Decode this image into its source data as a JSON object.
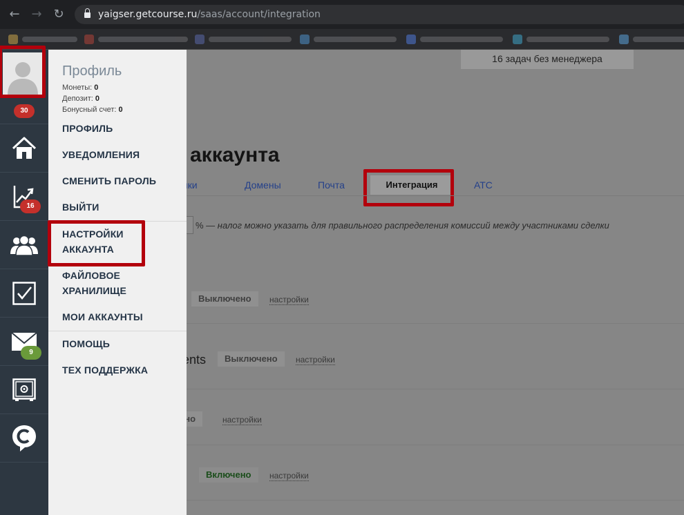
{
  "browser": {
    "back": "←",
    "forward": "→",
    "reload": "↻",
    "url_host": "yaigser.getcourse.ru",
    "url_path": "/saas/account/integration"
  },
  "sidebar": {
    "avatar_badge": "30",
    "growth_badge": "16",
    "mail_badge": "9"
  },
  "profile_menu": {
    "title": "Профиль",
    "coins_label": "Монеты:",
    "coins_value": "0",
    "deposit_label": "Депозит:",
    "deposit_value": "0",
    "bonus_label": "Бонусный счет:",
    "bonus_value": "0",
    "items": {
      "profile": "ПРОФИЛЬ",
      "notifications": "УВЕДОМЛЕНИЯ",
      "change_password": "СМЕНИТЬ ПАРОЛЬ",
      "logout": "ВЫЙТИ",
      "account_settings_1": "НАСТРОЙКИ",
      "account_settings_2": "АККАУНТА",
      "file_storage_1": "ФАЙЛОВОЕ",
      "file_storage_2": "ХРАНИЛИЩЕ",
      "my_accounts": "МОИ АККАУНТЫ",
      "help": "ПОМОЩЬ",
      "tech_support": "ТЕХ ПОДДЕРЖКА"
    }
  },
  "page": {
    "tasks_banner": "16 задач без менеджера",
    "title_fragment": "аккаунта",
    "tabs": {
      "settings_fragment": "ойки",
      "domains": "Домены",
      "mail": "Почта",
      "integration": "Интеграция",
      "ats": "АТС"
    },
    "tax_suffix": "% — ",
    "tax_hint": "налог можно указать для правильного распределения комиссий между участниками сделки",
    "rows": [
      {
        "label": "",
        "status": "Выключено",
        "link": "настройки"
      },
      {
        "label": "ents",
        "status": "Выключено",
        "link": "настройки"
      },
      {
        "label": "",
        "status": "ено",
        "link": "настройки"
      },
      {
        "label": "",
        "status": "Включено",
        "link": "настройки"
      }
    ]
  },
  "colors": {
    "highlight": "#b3000c",
    "sidebar_bg": "#2d3741",
    "badge_red": "#c4302b",
    "badge_green": "#6a9a3a"
  }
}
